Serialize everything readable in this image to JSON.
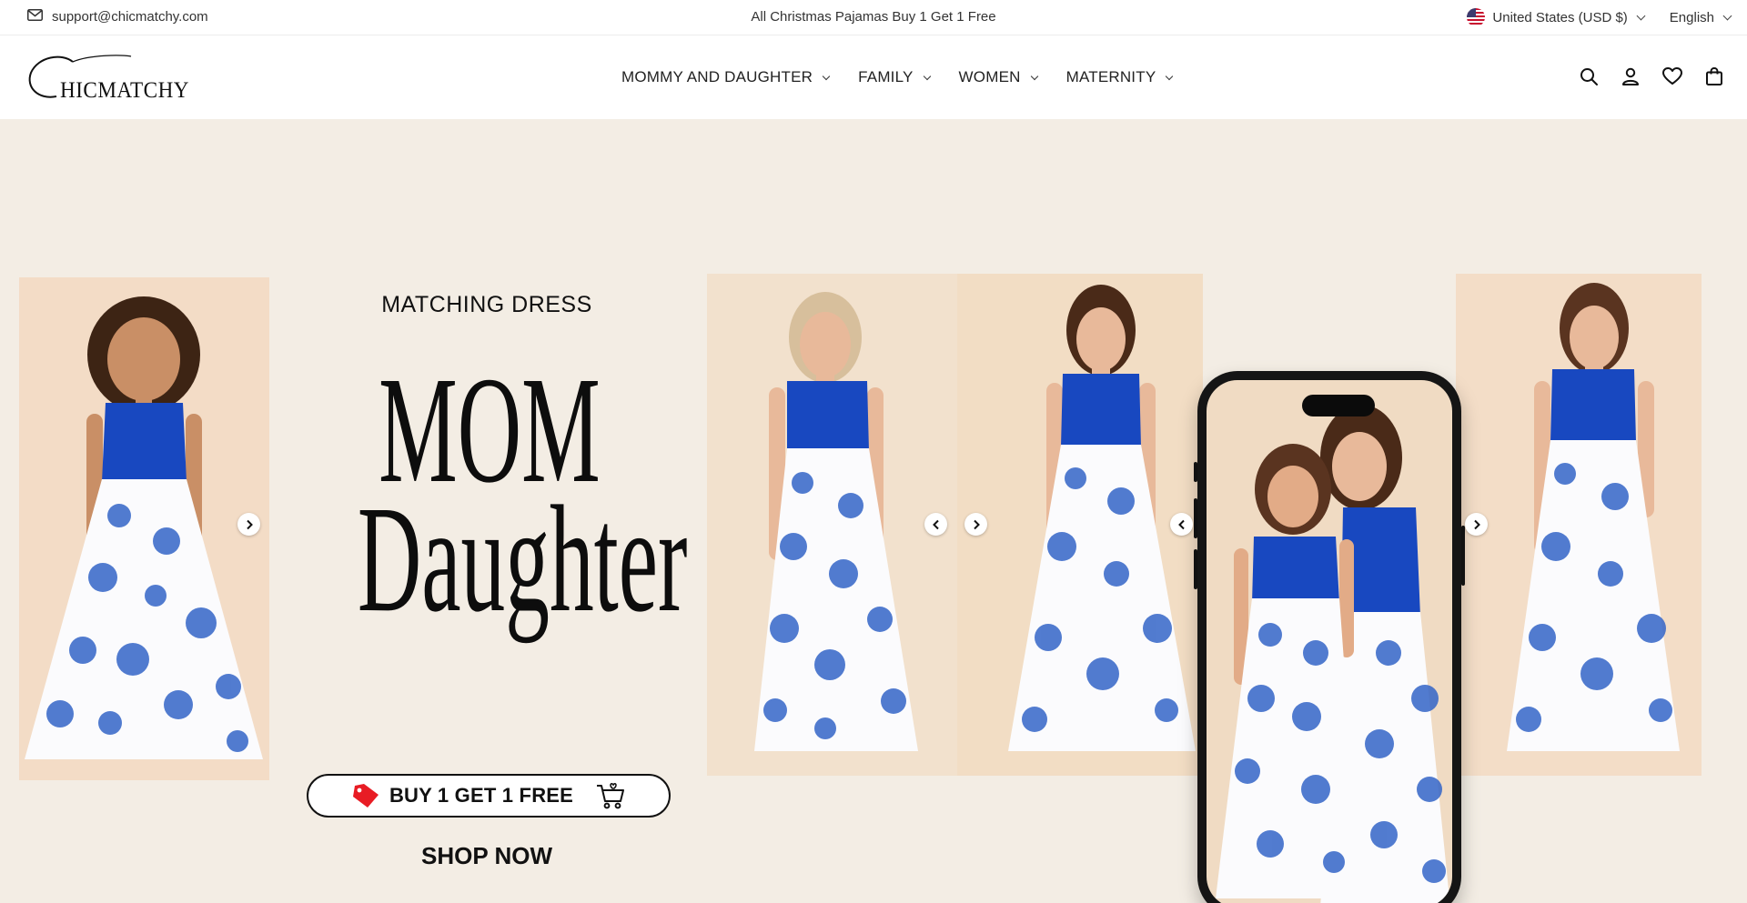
{
  "topbar": {
    "email": "support@chicmatchy.com",
    "announcement": "All Christmas Pajamas Buy 1 Get 1 Free",
    "country": "United States (USD $)",
    "language": "English"
  },
  "header": {
    "logo": "CHICMATCHY",
    "nav": [
      {
        "label": "MOMMY AND DAUGHTER"
      },
      {
        "label": "FAMILY"
      },
      {
        "label": "WOMEN"
      },
      {
        "label": "MATERNITY"
      }
    ],
    "icons": [
      "search-icon",
      "account-icon",
      "wishlist-icon",
      "cart-icon"
    ]
  },
  "hero": {
    "kicker": "MATCHING DRESS",
    "headline_1": "MOM",
    "headline_2": "Daughter",
    "offer": "BUY 1 GET 1 FREE",
    "cta": "SHOP NOW",
    "colors": {
      "background": "#f3ede4",
      "dress_blue": "#1848c0",
      "floral_blue": "#3465c8"
    }
  }
}
